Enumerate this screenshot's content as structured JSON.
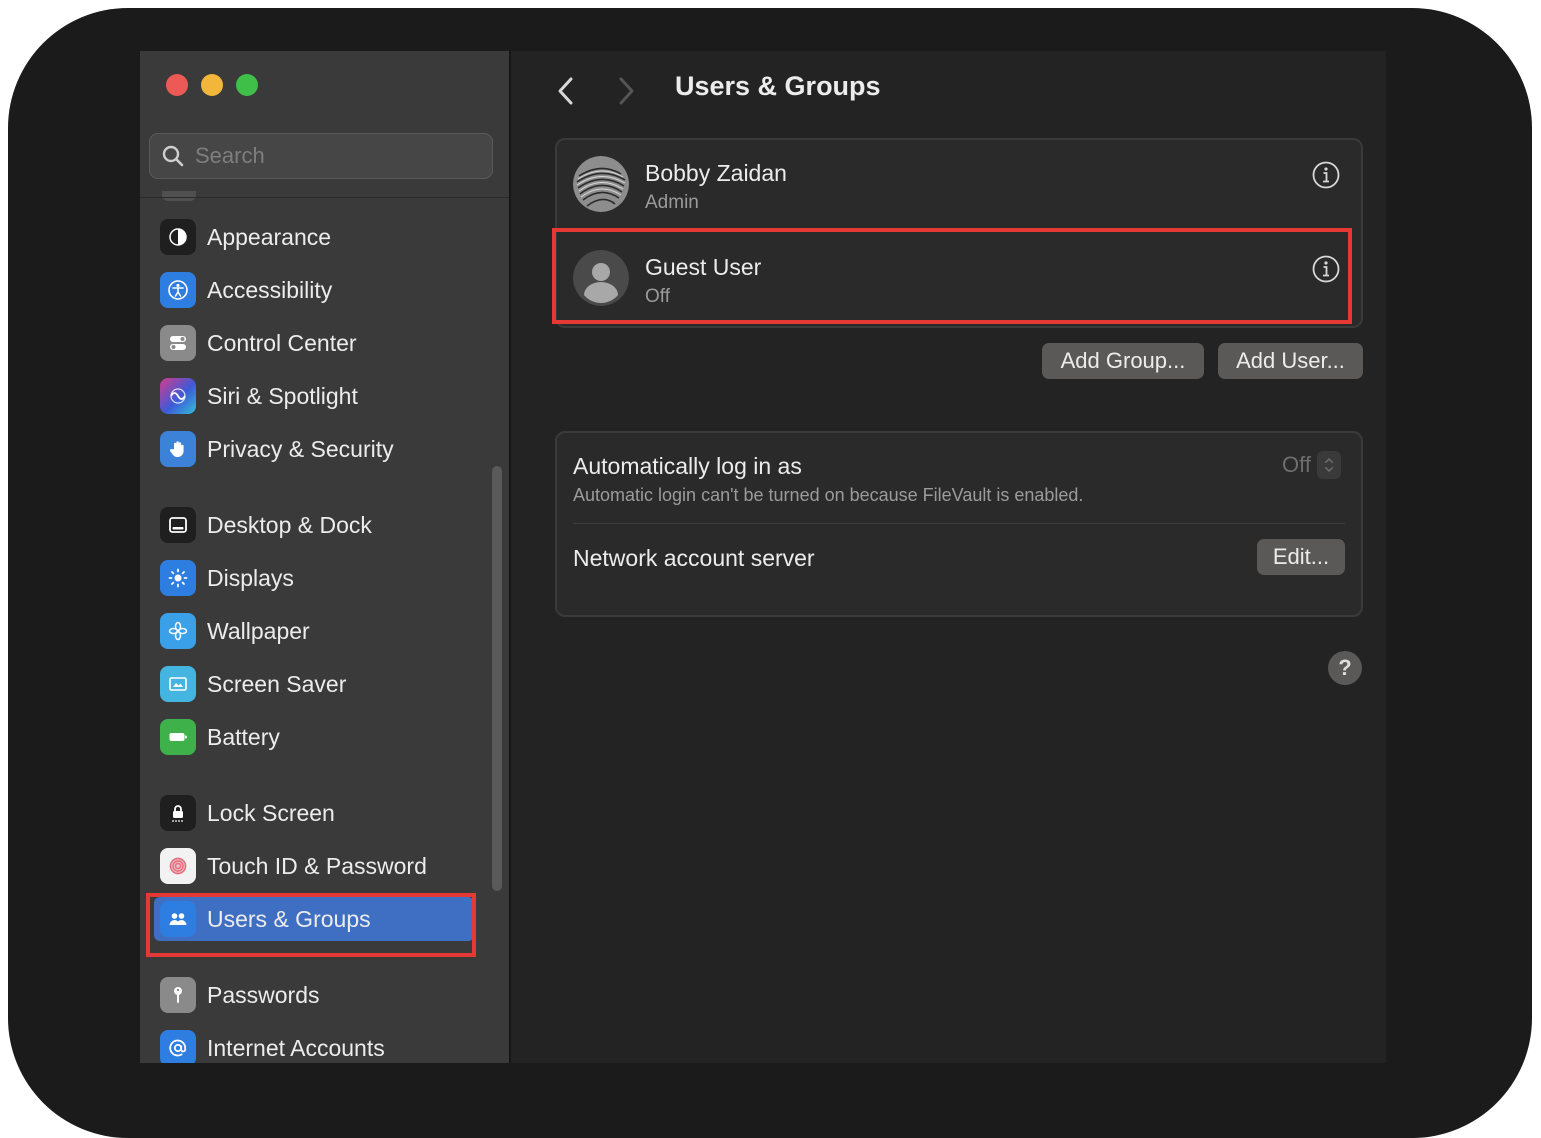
{
  "window": {
    "title": "Users & Groups",
    "traffic_lights": [
      "close",
      "minimize",
      "zoom"
    ]
  },
  "sidebar": {
    "search_placeholder": "Search",
    "items": [
      {
        "label": "Appearance",
        "icon": "appearance-icon",
        "color": "#1f1f1f"
      },
      {
        "label": "Accessibility",
        "icon": "accessibility-icon",
        "color": "#2e7de0"
      },
      {
        "label": "Control Center",
        "icon": "control-center-icon",
        "color": "#8a8a8a"
      },
      {
        "label": "Siri & Spotlight",
        "icon": "siri-icon",
        "color": "#5b3fa8"
      },
      {
        "label": "Privacy & Security",
        "icon": "hand-icon",
        "color": "#3b82d8"
      },
      {
        "label": "Desktop & Dock",
        "icon": "dock-icon",
        "color": "#1f1f1f"
      },
      {
        "label": "Displays",
        "icon": "sun-icon",
        "color": "#2e7de0"
      },
      {
        "label": "Wallpaper",
        "icon": "wallpaper-icon",
        "color": "#3aa0e8"
      },
      {
        "label": "Screen Saver",
        "icon": "screen-saver-icon",
        "color": "#44b4e0"
      },
      {
        "label": "Battery",
        "icon": "battery-icon",
        "color": "#3fb14a"
      },
      {
        "label": "Lock Screen",
        "icon": "lock-icon",
        "color": "#1f1f1f"
      },
      {
        "label": "Touch ID & Password",
        "icon": "fingerprint-icon",
        "color": "#f2f2f2"
      },
      {
        "label": "Users & Groups",
        "icon": "users-icon",
        "color": "#2e7de0",
        "selected": true
      },
      {
        "label": "Passwords",
        "icon": "key-icon",
        "color": "#8a8a8a"
      },
      {
        "label": "Internet Accounts",
        "icon": "at-icon",
        "color": "#2e7de0"
      }
    ]
  },
  "users": [
    {
      "name": "Bobby Zaidan",
      "role": "Admin"
    },
    {
      "name": "Guest User",
      "role": "Off"
    }
  ],
  "buttons": {
    "add_group": "Add Group...",
    "add_user": "Add User...",
    "edit": "Edit...",
    "help": "?"
  },
  "auto_login": {
    "title": "Automatically log in as",
    "note": "Automatic login can't be turned on because FileVault is enabled.",
    "value": "Off"
  },
  "network": {
    "label": "Network account server"
  },
  "highlight_color": "#e53935"
}
